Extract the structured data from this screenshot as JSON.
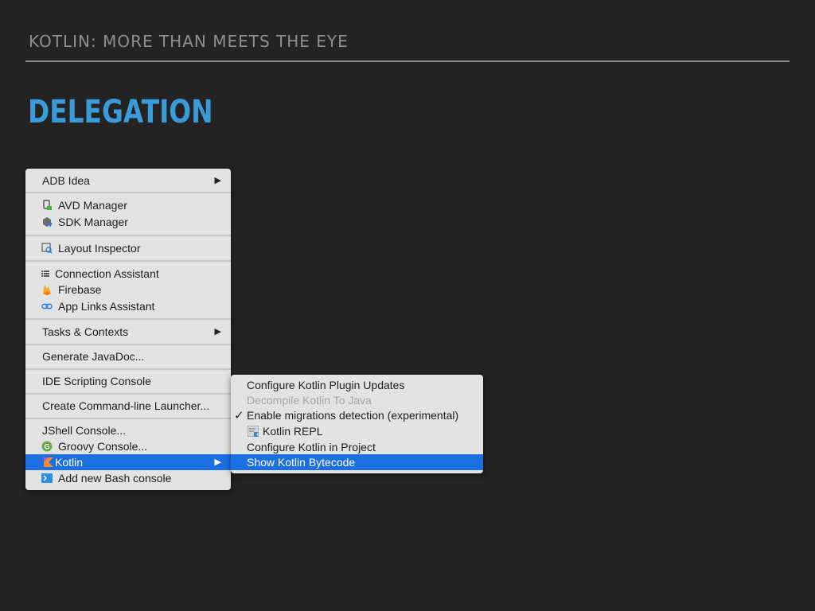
{
  "slide": {
    "header": "KOTLIN: MORE THAN MEETS THE EYE",
    "title": "DELEGATION"
  },
  "colors": {
    "background": "#232323",
    "title_blue": "#3b9ad8",
    "menu_bg": "#e3e3e3",
    "selection_blue": "#1c6fe0"
  },
  "main_menu": {
    "items": [
      {
        "label": "ADB Idea",
        "submenu_arrow": "▶"
      },
      {
        "label": "AVD Manager",
        "icon": "avd-manager-icon"
      },
      {
        "label": "SDK Manager",
        "icon": "sdk-manager-icon"
      },
      {
        "label": "Layout Inspector",
        "icon": "layout-inspector-icon"
      },
      {
        "label": "Connection Assistant",
        "icon": "list-icon"
      },
      {
        "label": "Firebase",
        "icon": "firebase-icon"
      },
      {
        "label": "App Links Assistant",
        "icon": "link-icon"
      },
      {
        "label": "Tasks & Contexts",
        "submenu_arrow": "▶"
      },
      {
        "label": "Generate JavaDoc..."
      },
      {
        "label": "IDE Scripting Console"
      },
      {
        "label": "Create Command-line Launcher..."
      },
      {
        "label": "JShell Console..."
      },
      {
        "label": "Groovy Console...",
        "icon": "groovy-icon"
      },
      {
        "label": "Kotlin",
        "icon": "kotlin-icon",
        "submenu_arrow": "▶",
        "selected": true
      },
      {
        "label": "Add new Bash console",
        "icon": "bash-icon"
      }
    ]
  },
  "kotlin_submenu": {
    "items": [
      {
        "label": "Configure Kotlin Plugin Updates"
      },
      {
        "label": "Decompile Kotlin To Java",
        "disabled": true
      },
      {
        "label": "Enable migrations detection (experimental)",
        "checked": true,
        "check_mark": "✓"
      },
      {
        "label": "Kotlin REPL",
        "icon": "kotlin-repl-icon"
      },
      {
        "label": "Configure Kotlin in Project"
      },
      {
        "label": "Show Kotlin Bytecode",
        "selected": true
      }
    ]
  }
}
